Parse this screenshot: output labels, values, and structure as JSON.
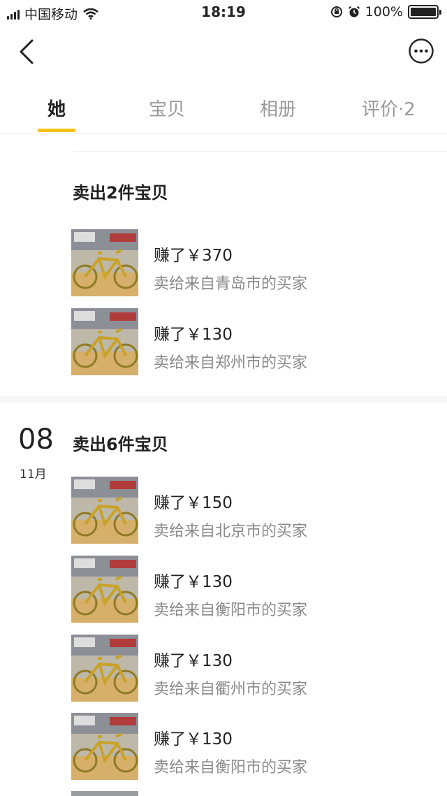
{
  "status_bar": {
    "carrier": "中国移动",
    "time": "18:19",
    "battery": "100%"
  },
  "tabs": [
    {
      "label": "她",
      "active": true
    },
    {
      "label": "宝贝",
      "active": false
    },
    {
      "label": "相册",
      "active": false
    },
    {
      "label": "评价·2",
      "active": false
    }
  ],
  "groups": [
    {
      "title": "卖出2件宝贝",
      "items": [
        {
          "earned": "赚了￥370",
          "buyer": "卖给来自青岛市的买家"
        },
        {
          "earned": "赚了￥130",
          "buyer": "卖给来自郑州市的买家"
        }
      ]
    },
    {
      "day": "08",
      "month": "11月",
      "title": "卖出6件宝贝",
      "items": [
        {
          "earned": "赚了￥150",
          "buyer": "卖给来自北京市的买家"
        },
        {
          "earned": "赚了￥130",
          "buyer": "卖给来自衡阳市的买家"
        },
        {
          "earned": "赚了￥130",
          "buyer": "卖给来自衢州市的买家"
        },
        {
          "earned": "赚了￥130",
          "buyer": "卖给来自衡阳市的买家"
        }
      ]
    }
  ],
  "colors": {
    "accent": "#f6c21b",
    "text_primary": "#222222",
    "text_secondary": "#8a8a8a",
    "tab_inactive": "#999999"
  },
  "icons": {
    "back": "chevron-left-icon",
    "more": "more-dots-icon",
    "wifi": "wifi-icon",
    "alarm": "alarm-icon",
    "rotation_lock": "rotation-lock-icon",
    "battery": "battery-icon"
  }
}
